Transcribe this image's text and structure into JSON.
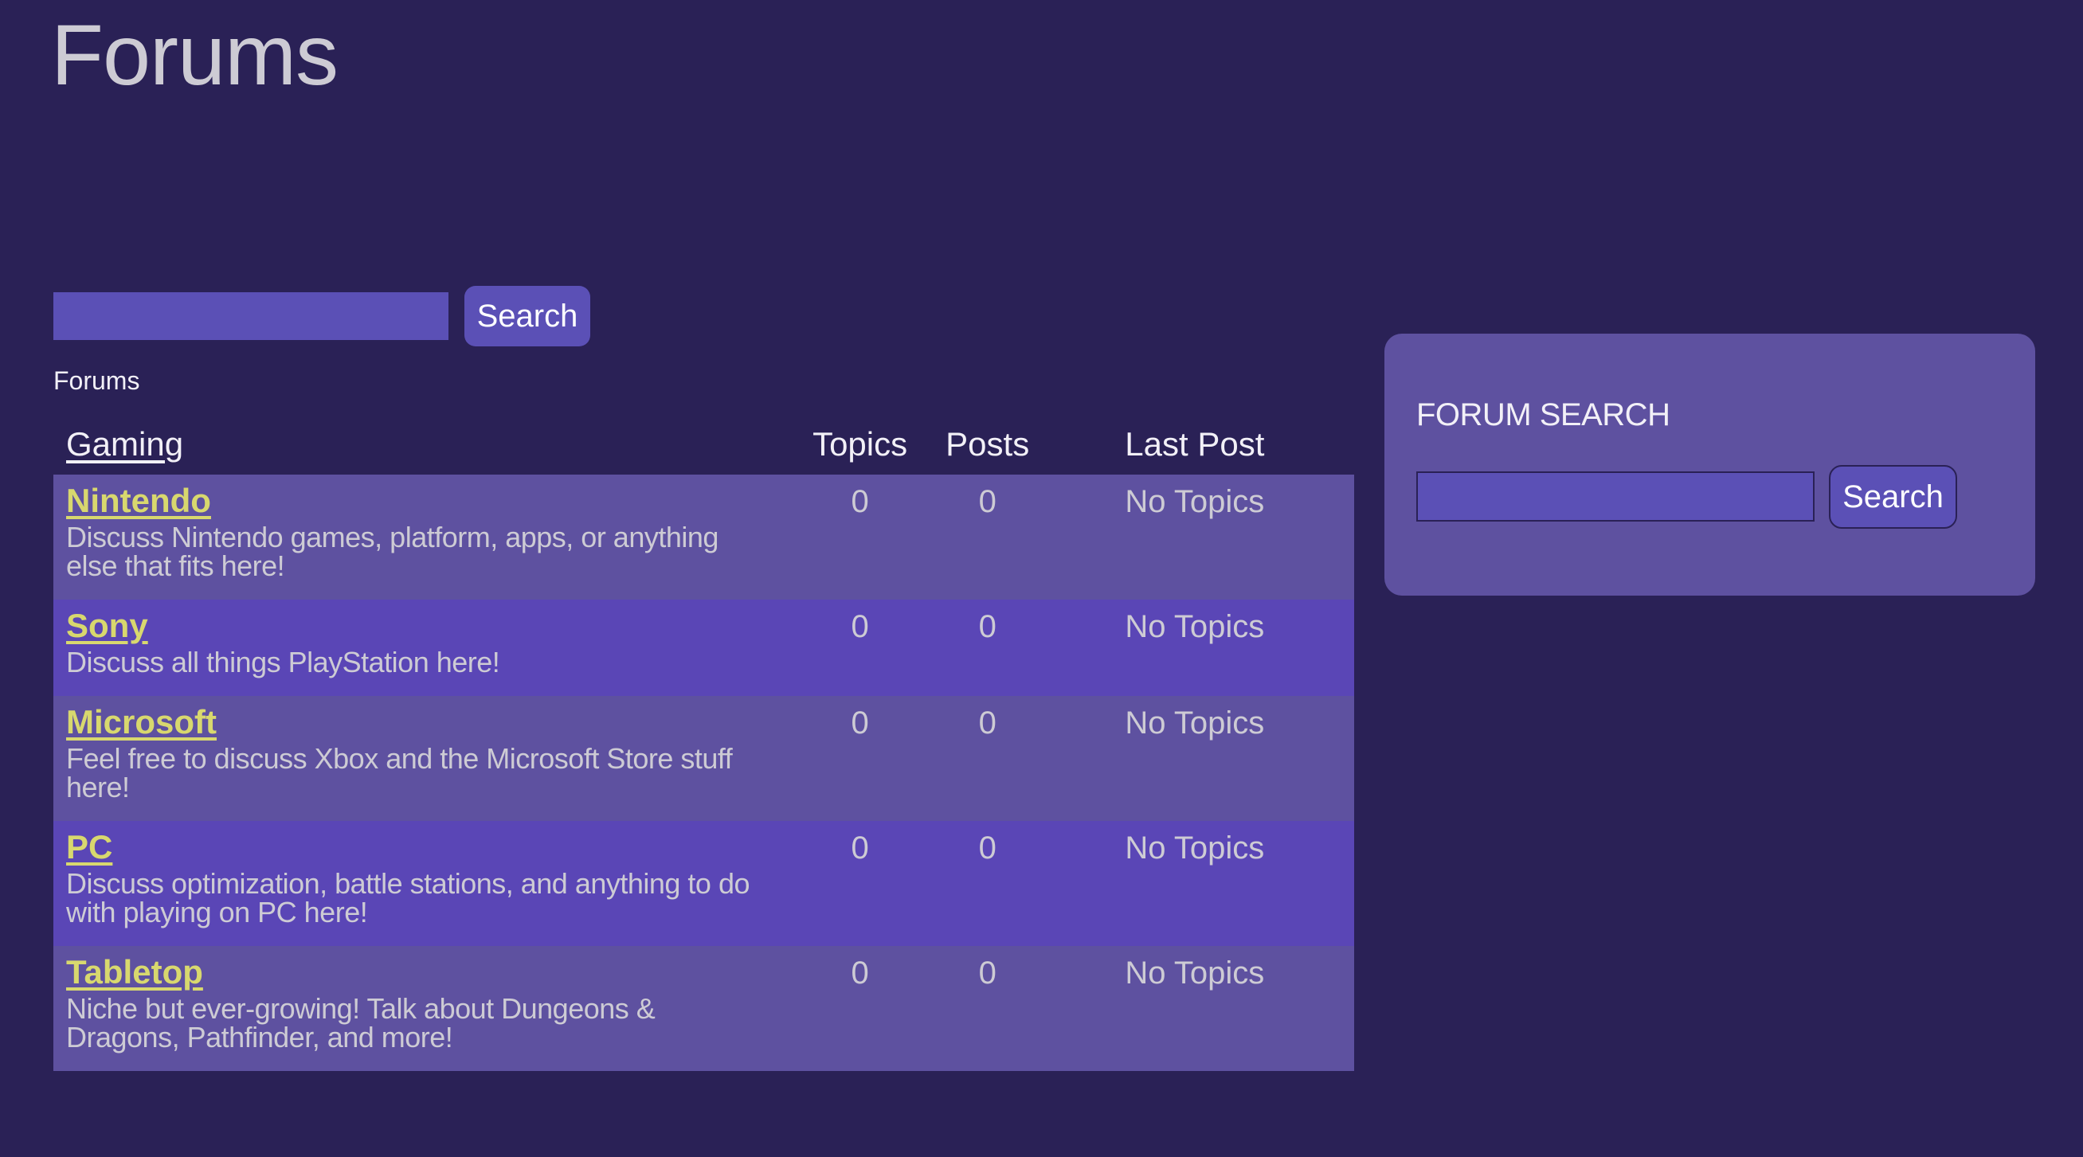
{
  "page": {
    "title": "Forums"
  },
  "top_search": {
    "input_value": "",
    "placeholder": "",
    "button_label": "Search"
  },
  "breadcrumb_label": "Forums",
  "table": {
    "headers": {
      "category": "Gaming",
      "topics": "Topics",
      "posts": "Posts",
      "last_post": "Last Post"
    },
    "rows": [
      {
        "name": "Nintendo",
        "description": "Discuss Nintendo games, platform, apps, or anything else that fits here!",
        "topics": "0",
        "posts": "0",
        "last_post": "No Topics"
      },
      {
        "name": "Sony",
        "description": "Discuss all things PlayStation here!",
        "topics": "0",
        "posts": "0",
        "last_post": "No Topics"
      },
      {
        "name": "Microsoft",
        "description": "Feel free to discuss Xbox and the Microsoft Store stuff here!",
        "topics": "0",
        "posts": "0",
        "last_post": "No Topics"
      },
      {
        "name": "PC",
        "description": "Discuss optimization, battle stations, and anything to do with playing on PC here!",
        "topics": "0",
        "posts": "0",
        "last_post": "No Topics"
      },
      {
        "name": "Tabletop",
        "description": "Niche but ever-growing! Talk about Dungeons & Dragons, Pathfinder, and more!",
        "topics": "0",
        "posts": "0",
        "last_post": "No Topics"
      }
    ]
  },
  "side_panel": {
    "heading": "FORUM SEARCH",
    "input_value": "",
    "placeholder": "",
    "button_label": "Search"
  },
  "colors": {
    "background": "#2a2156",
    "row_odd": "#5e51a0",
    "row_even": "#5a46b6",
    "input": "#5b50b6",
    "link": "#d8d86e",
    "text_muted": "#cdcbd4"
  }
}
